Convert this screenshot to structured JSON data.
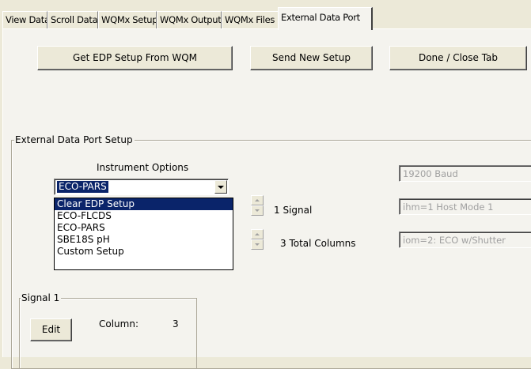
{
  "tabs": [
    "View Data",
    "Scroll Data",
    "WQMx Setup",
    "WQMx Output",
    "WQMx Files",
    "External Data Port"
  ],
  "active_tab": "External Data Port",
  "buttons": {
    "get_setup": "Get EDP Setup From WQM",
    "send_setup": "Send New Setup",
    "done_close": "Done / Close Tab",
    "edit": "Edit"
  },
  "edp_group": {
    "label": "External Data Port Setup",
    "instrument_options_label": "Instrument Options",
    "instrument_selected": "ECO-PARS",
    "instrument_options": [
      "Clear EDP Setup",
      "ECO-FLCDS",
      "ECO-PARS",
      "SBE18S pH",
      "Custom Setup"
    ],
    "highlighted_option": "Clear EDP Setup",
    "signals_text": "1 Signal",
    "columns_text": "3 Total Columns",
    "baud_field": "19200 Baud",
    "host_mode_field": "ihm=1  Host Mode 1",
    "output_mode_field": "iom=2:  ECO w/Shutter"
  },
  "signal_group": {
    "label": "Signal 1",
    "column_label": "Column:",
    "column_value": "3"
  }
}
